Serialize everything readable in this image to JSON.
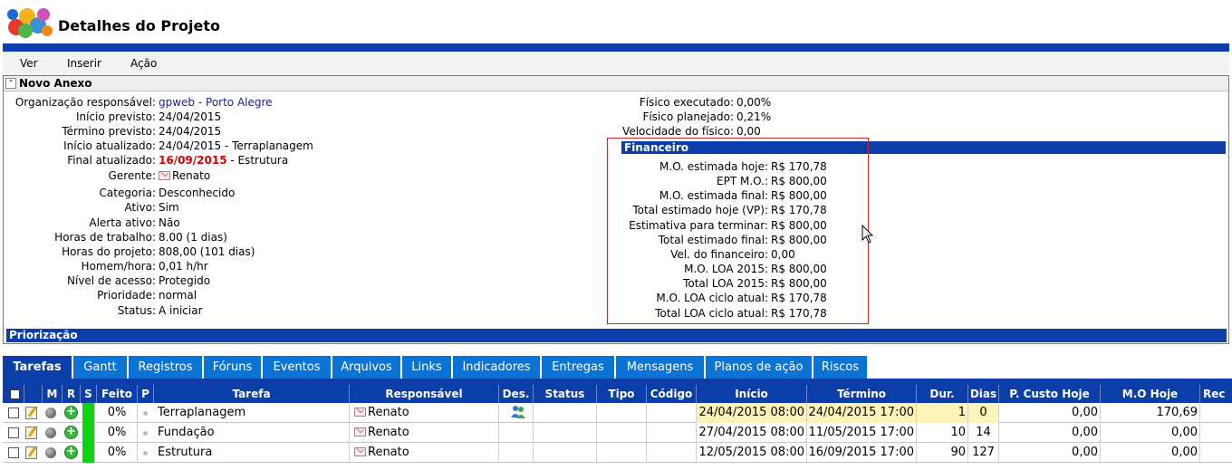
{
  "window": {
    "title": "Detalhes do Projeto"
  },
  "menu": [
    {
      "label": "Ver"
    },
    {
      "label": "Inserir"
    },
    {
      "label": "Ação"
    }
  ],
  "panel": {
    "title": "Novo Anexo"
  },
  "details": [
    {
      "label": "Organização responsável:",
      "value": "gpweb - Porto Alegre"
    },
    {
      "label": "Início previsto:",
      "value": "24/04/2015"
    },
    {
      "label": "Término previsto:",
      "value": "24/04/2015"
    },
    {
      "label": "Início atualizado:",
      "value": "24/04/2015 - Terraplanagem"
    },
    {
      "label": "Final atualizado:",
      "value_date": "16/09/2015",
      "value_rest": " - Estrutura"
    },
    {
      "label": "Gerente:",
      "value": "Renato"
    },
    {
      "label": "Categoria:",
      "value": "Desconhecido"
    },
    {
      "label": "Ativo:",
      "value": "Sim"
    },
    {
      "label": "Alerta ativo:",
      "value": "Não"
    },
    {
      "label": "Horas de trabalho:",
      "value": "8.00 (1 dias)"
    },
    {
      "label": "Horas do projeto:",
      "value": "808,00 (101 dias)"
    },
    {
      "label": "Homem/hora:",
      "value": "0,01 h/hr"
    },
    {
      "label": "Nível de acesso:",
      "value": "Protegido"
    },
    {
      "label": "Prioridade:",
      "value": "normal"
    },
    {
      "label": "Status:",
      "value": "A iniciar"
    }
  ],
  "physical": [
    {
      "label": "Físico executado:",
      "value": "0,00%"
    },
    {
      "label": "Físico planejado:",
      "value": "0,21%"
    },
    {
      "label": "Velocidade do físico:",
      "value": "0,00"
    }
  ],
  "financial": {
    "title": "Financeiro",
    "items": [
      {
        "label": "M.O. estimada hoje:",
        "value": "R$ 170,78"
      },
      {
        "label": "EPT M.O.:",
        "value": "R$ 800,00"
      },
      {
        "label": "M.O. estimada final:",
        "value": "R$ 800,00"
      },
      {
        "label": "Total estimado hoje (VP):",
        "value": "R$ 170,78"
      },
      {
        "label": "Estimativa para terminar:",
        "value": "R$ 800,00"
      },
      {
        "label": "Total estimado final:",
        "value": "R$ 800,00"
      },
      {
        "label": "Vel. do financeiro:",
        "value": "0,00"
      },
      {
        "label": "M.O. LOA 2015:",
        "value": "R$ 800,00"
      },
      {
        "label": "Total LOA 2015:",
        "value": "R$ 800,00"
      },
      {
        "label": "M.O. LOA ciclo atual:",
        "value": "R$ 170,78"
      },
      {
        "label": "Total LOA ciclo atual:",
        "value": "R$ 170,78"
      }
    ]
  },
  "prioritization": {
    "title": "Priorização"
  },
  "tabs": [
    {
      "label": "Tarefas",
      "active": true
    },
    {
      "label": "Gantt"
    },
    {
      "label": "Registros"
    },
    {
      "label": "Fóruns"
    },
    {
      "label": "Eventos"
    },
    {
      "label": "Arquivos"
    },
    {
      "label": "Links"
    },
    {
      "label": "Indicadores"
    },
    {
      "label": "Entregas"
    },
    {
      "label": "Mensagens"
    },
    {
      "label": "Planos de ação"
    },
    {
      "label": "Riscos"
    }
  ],
  "table": {
    "headers": {
      "m": "M",
      "r": "R",
      "s": "S",
      "feito": "Feito",
      "p": "P",
      "tarefa": "Tarefa",
      "responsavel": "Responsável",
      "des": "Des.",
      "status": "Status",
      "tipo": "Tipo",
      "codigo": "Código",
      "inicio": "Início",
      "termino": "Término",
      "dur": "Dur.",
      "dias": "Dias",
      "p_custo_hoje": "P. Custo Hoje",
      "mo_hoje": "M.O Hoje",
      "rec": "Rec"
    },
    "rows": [
      {
        "feito": "0%",
        "tarefa": "Terraplanagem",
        "responsavel": "Renato",
        "inicio": "24/04/2015 08:00",
        "termino": "24/04/2015 17:00",
        "dur": "1",
        "dias": "0",
        "p_custo_hoje": "0,00",
        "mo_hoje": "170,69",
        "highlight": true,
        "has_des_icon": true
      },
      {
        "feito": "0%",
        "tarefa": "Fundação",
        "responsavel": "Renato",
        "inicio": "27/04/2015 08:00",
        "termino": "11/05/2015 17:00",
        "dur": "10",
        "dias": "14",
        "p_custo_hoje": "0,00",
        "mo_hoje": "0,00",
        "highlight": false,
        "has_des_icon": false
      },
      {
        "feito": "0%",
        "tarefa": "Estrutura",
        "responsavel": "Renato",
        "inicio": "12/05/2015 08:00",
        "termino": "16/09/2015 17:00",
        "dur": "90",
        "dias": "127",
        "p_custo_hoje": "0,00",
        "mo_hoje": "0,00",
        "highlight": false,
        "has_des_icon": false
      }
    ]
  },
  "colors": {
    "header_blue": "#0b3ea8",
    "tab_blue": "#0a74d6",
    "overdue_red": "#d50000",
    "highlight_yellow": "#fdf5b8",
    "status_green": "#0ed20e"
  }
}
